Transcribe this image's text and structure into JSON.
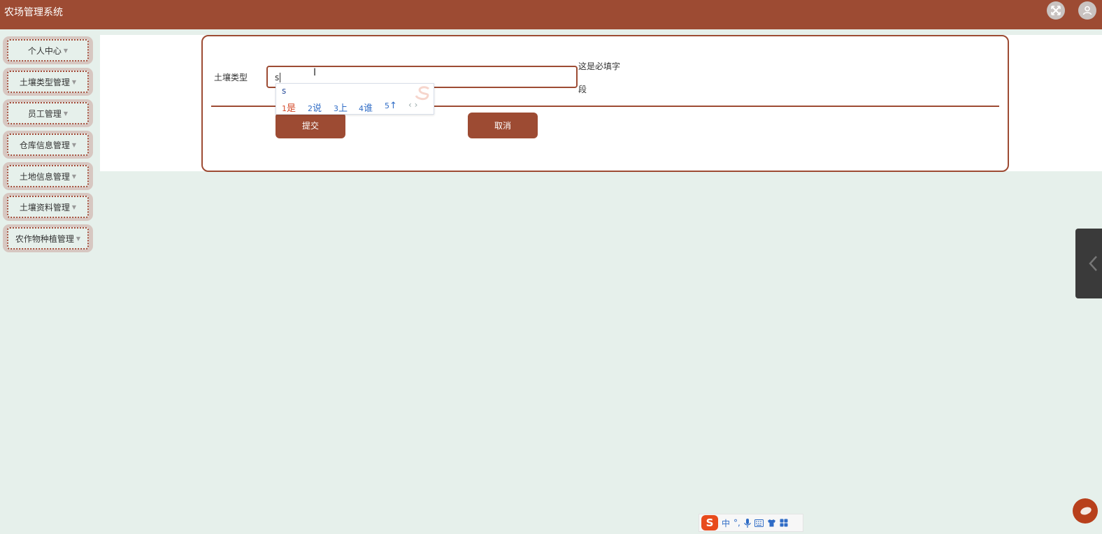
{
  "app": {
    "title": "农场管理系统"
  },
  "header": {
    "icons": [
      "fullscreen-icon",
      "user-icon"
    ]
  },
  "sidebar": {
    "items": [
      {
        "label": "个人中心"
      },
      {
        "label": "土壤类型管理"
      },
      {
        "label": "员工管理"
      },
      {
        "label": "仓库信息管理"
      },
      {
        "label": "土地信息管理"
      },
      {
        "label": "土壤资料管理"
      },
      {
        "label": "农作物种植管理"
      }
    ]
  },
  "form": {
    "field_label": "土壤类型",
    "field_value": "s",
    "required_line1": "这是必填字",
    "required_line2": "段",
    "submit_label": "提交",
    "cancel_label": "取消"
  },
  "ime_popup": {
    "composition": "s",
    "candidates": [
      {
        "num": "1",
        "text": "是"
      },
      {
        "num": "2",
        "text": "说"
      },
      {
        "num": "3",
        "text": "上"
      },
      {
        "num": "4",
        "text": "谁"
      },
      {
        "num": "5",
        "text": "↑"
      }
    ],
    "nav": "‹ ›"
  },
  "ime_toolbar": {
    "logo": "S",
    "mode": "中",
    "punct": "°,"
  },
  "colors": {
    "accent": "#9d4b33",
    "background": "#e6f0eb",
    "panel": "#ffffff"
  }
}
